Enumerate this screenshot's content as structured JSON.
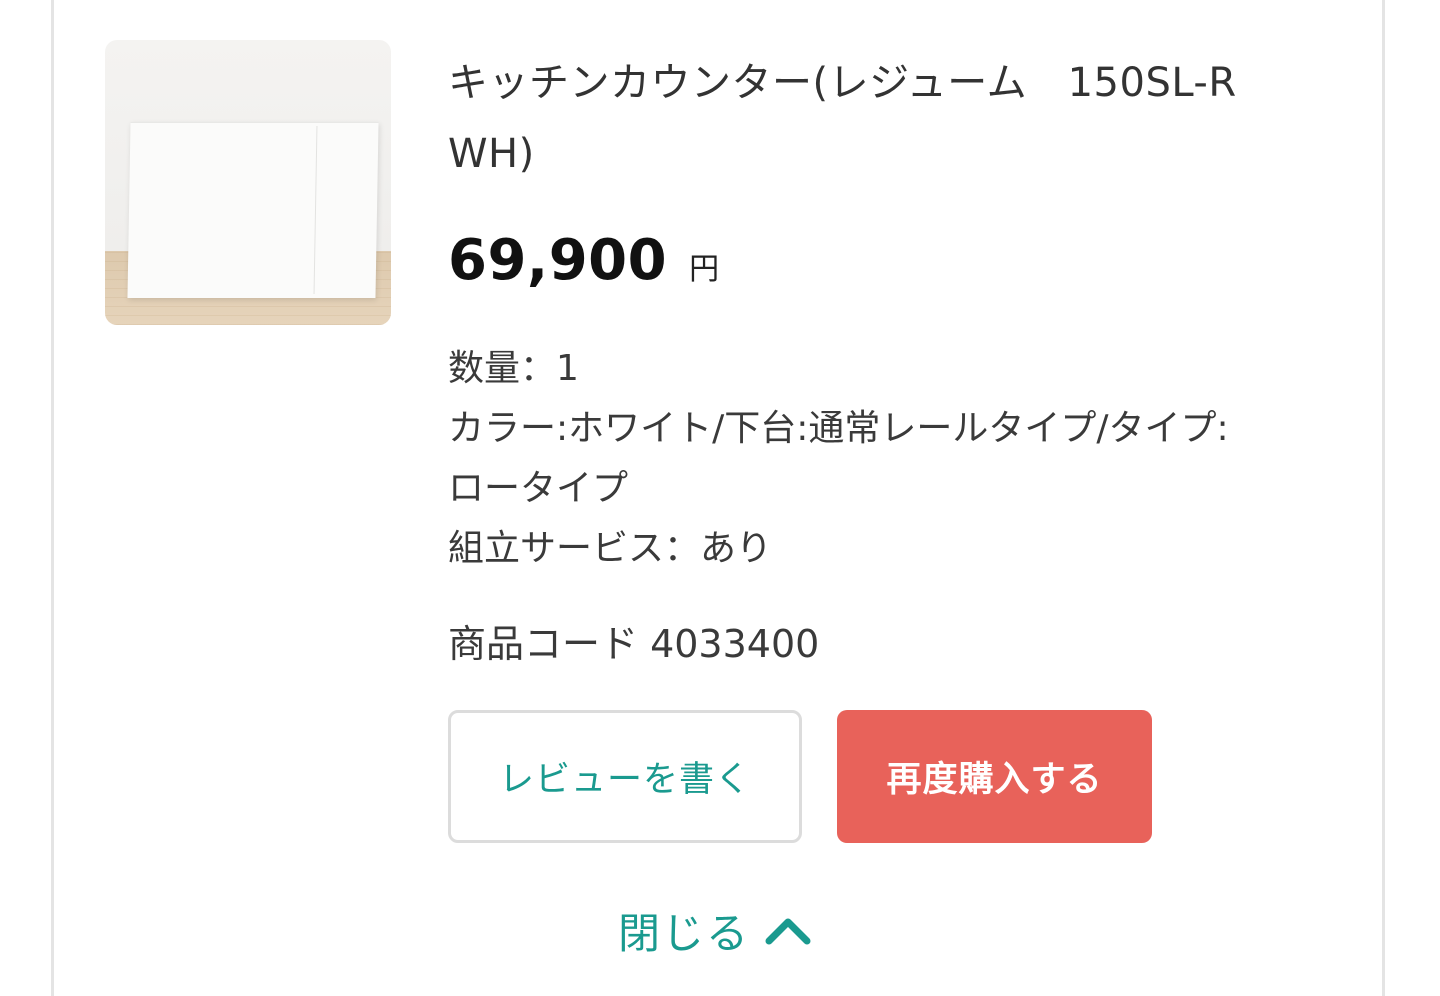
{
  "product": {
    "name": "キッチンカウンター(レジューム　150SL-R WH)",
    "price": "69,900",
    "currency": "円",
    "image_alt": "product-photo"
  },
  "details": {
    "quantity": "数量：1",
    "options_line1": "カラー:ホワイト/下台:通常レールタイプ/タイプ:",
    "options_line2": "ロータイプ",
    "assembly": "組立サービス：あり"
  },
  "product_code": "商品コード 4033400",
  "actions": {
    "review_label": "レビューを書く",
    "rebuy_label": "再度購入する"
  },
  "toggle": {
    "close_label": "閉じる",
    "icon": "chevron-up-icon"
  },
  "colors": {
    "accent_teal": "#1a9a8f",
    "rebuy_red": "#e8625a"
  }
}
